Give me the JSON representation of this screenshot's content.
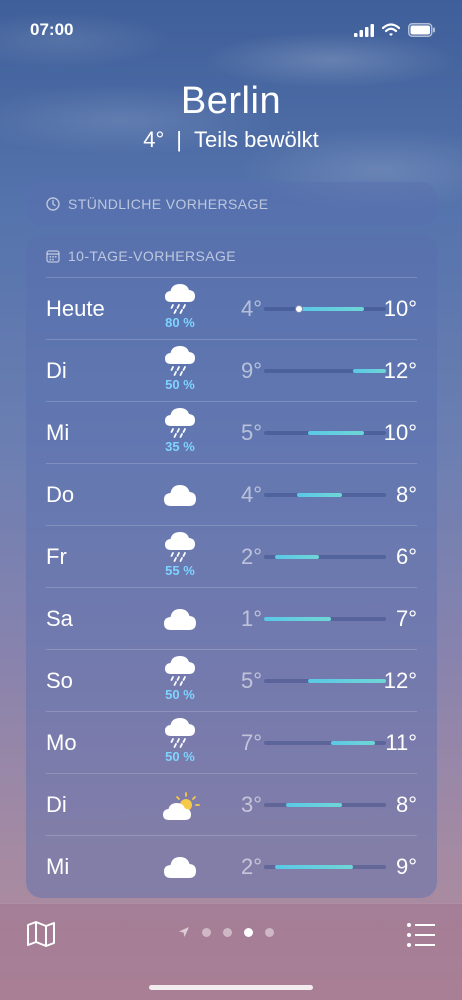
{
  "status": {
    "time": "07:00"
  },
  "header": {
    "city": "Berlin",
    "temp": "4°",
    "separator": "|",
    "condition": "Teils bewölkt"
  },
  "hourly": {
    "title": "STÜNDLICHE VORHERSAGE"
  },
  "daily": {
    "title": "10-TAGE-VORHERSAGE",
    "range_scale_min": 1,
    "range_scale_max": 12,
    "rows": [
      {
        "day": "Heute",
        "icon": "rain-cloud-icon",
        "precip": "80 %",
        "low": "4°",
        "high": "10°",
        "lo": 4,
        "hi": 10,
        "current": 4.2
      },
      {
        "day": "Di",
        "icon": "rain-cloud-icon",
        "precip": "50 %",
        "low": "9°",
        "high": "12°",
        "lo": 9,
        "hi": 12
      },
      {
        "day": "Mi",
        "icon": "rain-cloud-icon",
        "precip": "35 %",
        "low": "5°",
        "high": "10°",
        "lo": 5,
        "hi": 10
      },
      {
        "day": "Do",
        "icon": "cloud-icon",
        "precip": "",
        "low": "4°",
        "high": "8°",
        "lo": 4,
        "hi": 8
      },
      {
        "day": "Fr",
        "icon": "rain-cloud-icon",
        "precip": "55 %",
        "low": "2°",
        "high": "6°",
        "lo": 2,
        "hi": 6
      },
      {
        "day": "Sa",
        "icon": "cloud-icon",
        "precip": "",
        "low": "1°",
        "high": "7°",
        "lo": 1,
        "hi": 7
      },
      {
        "day": "So",
        "icon": "rain-cloud-icon",
        "precip": "50 %",
        "low": "5°",
        "high": "12°",
        "lo": 5,
        "hi": 12
      },
      {
        "day": "Mo",
        "icon": "rain-cloud-icon",
        "precip": "50 %",
        "low": "7°",
        "high": "11°",
        "lo": 7,
        "hi": 11
      },
      {
        "day": "Di",
        "icon": "partly-sunny-icon",
        "precip": "",
        "low": "3°",
        "high": "8°",
        "lo": 3,
        "hi": 8
      },
      {
        "day": "Mi",
        "icon": "cloud-icon",
        "precip": "",
        "low": "2°",
        "high": "9°",
        "lo": 2,
        "hi": 9
      }
    ]
  },
  "bottom": {
    "page_count": 4,
    "active_page": 3
  }
}
